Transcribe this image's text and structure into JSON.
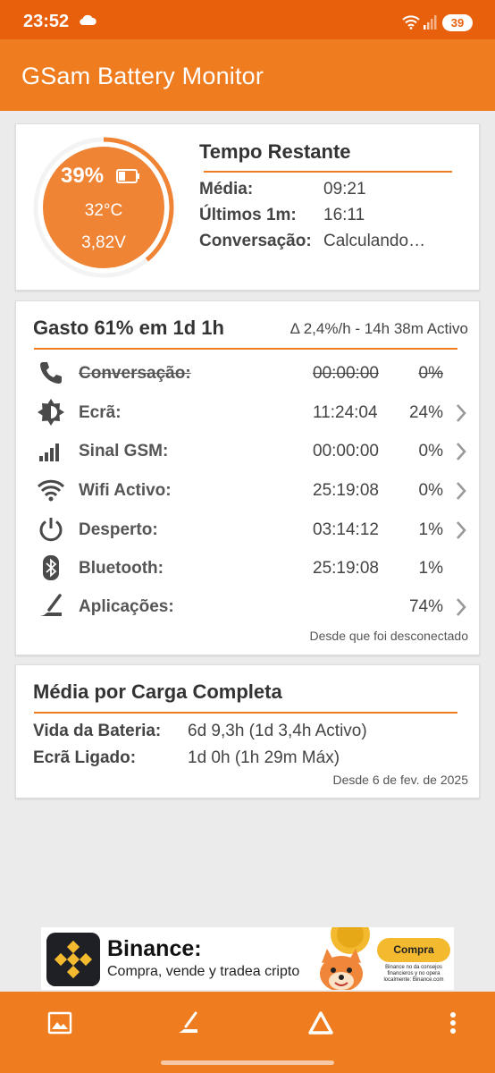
{
  "status_bar": {
    "time": "23:52",
    "battery": "39"
  },
  "app_bar": {
    "title": "GSam Battery Monitor"
  },
  "battery_gauge": {
    "percent": "39%",
    "level": 0.39,
    "temperature": "32°C",
    "voltage": "3,82V"
  },
  "time_remaining": {
    "title": "Tempo Restante",
    "rows": [
      {
        "label": "Média:",
        "value": "09:21"
      },
      {
        "label": "Últimos 1m:",
        "value": "16:11"
      },
      {
        "label": "Conversação:",
        "value": "Calculando…"
      }
    ]
  },
  "usage": {
    "title": "Gasto 61% em 1d 1h",
    "rate": "Δ 2,4%/h - 14h 38m Activo",
    "items": [
      {
        "icon": "phone-icon",
        "label": "Conversação:",
        "time": "00:00:00",
        "percent": "0%",
        "struck": true,
        "chevron": false
      },
      {
        "icon": "screen-brightness-icon",
        "label": "Ecrã:",
        "time": "11:24:04",
        "percent": "24%",
        "struck": false,
        "chevron": true
      },
      {
        "icon": "cell-signal-icon",
        "label": "Sinal GSM:",
        "time": "00:00:00",
        "percent": "0%",
        "struck": false,
        "chevron": true
      },
      {
        "icon": "wifi-icon",
        "label": "Wifi Activo:",
        "time": "25:19:08",
        "percent": "0%",
        "struck": false,
        "chevron": true
      },
      {
        "icon": "power-icon",
        "label": "Desperto:",
        "time": "03:14:12",
        "percent": "1%",
        "struck": false,
        "chevron": true
      },
      {
        "icon": "bluetooth-icon",
        "label": "Bluetooth:",
        "time": "25:19:08",
        "percent": "1%",
        "struck": false,
        "chevron": false
      },
      {
        "icon": "apps-icon",
        "label": "Aplicações:",
        "time": "",
        "percent": "74%",
        "struck": false,
        "chevron": true
      }
    ],
    "footer": "Desde que foi desconectado"
  },
  "full_charge": {
    "title": "Média por Carga Completa",
    "rows": [
      {
        "label": "Vida da Bateria:",
        "value": "6d 9,3h (1d 3,4h Activo)"
      },
      {
        "label": "Ecrã Ligado:",
        "value": "1d 0h (1h 29m Máx)"
      }
    ],
    "footer": "Desde 6 de fev. de 2025"
  },
  "ad": {
    "brand": "Binance:",
    "tagline": "Compra, vende y tradea cripto",
    "cta": "Compra",
    "disclaimer": "Binance no da consejos financieros y no opera localmente: Binance.com"
  },
  "colors": {
    "accent": "#ef7d20",
    "status_bar": "#e8600c",
    "gauge_fill": "#ef8435"
  }
}
